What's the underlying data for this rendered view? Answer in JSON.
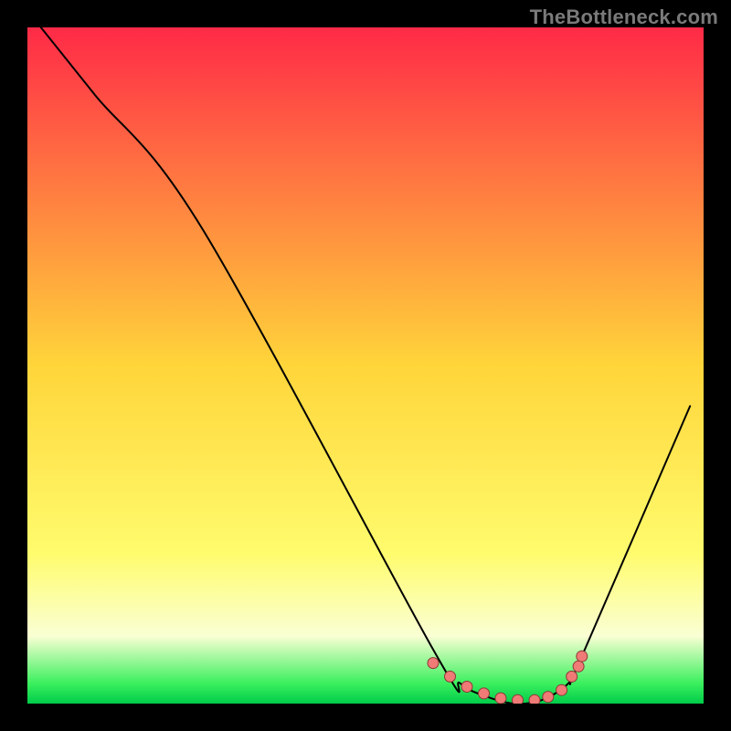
{
  "watermark": "TheBottleneck.com",
  "chart_data": {
    "type": "line",
    "title": "",
    "xlabel": "",
    "ylabel": "",
    "xlim": [
      0,
      100
    ],
    "ylim": [
      0,
      100
    ],
    "grid": false,
    "legend": "none",
    "background_gradient": {
      "stops": [
        {
          "offset": 0.0,
          "color": "#ff2a47"
        },
        {
          "offset": 0.5,
          "color": "#ffd53a"
        },
        {
          "offset": 0.78,
          "color": "#fffc6e"
        },
        {
          "offset": 0.9,
          "color": "#faffd4"
        },
        {
          "offset": 0.97,
          "color": "#3bf05e"
        },
        {
          "offset": 1.0,
          "color": "#00cc4a"
        }
      ]
    },
    "series": [
      {
        "name": "bottleneck-curve",
        "color": "#000000",
        "width": 2,
        "x": [
          2,
          10,
          26,
          60,
          64,
          68,
          72,
          76,
          80,
          82,
          98
        ],
        "values": [
          100,
          90,
          70,
          8,
          3,
          1,
          0,
          0.5,
          3,
          7,
          44
        ]
      }
    ],
    "markers": {
      "name": "optimal-range-points",
      "color": "#ef7a76",
      "stroke": "#8c3a37",
      "radius": 6,
      "x": [
        60,
        62.5,
        65,
        67.5,
        70,
        72.5,
        75,
        77,
        79,
        80.5,
        81.5,
        82
      ],
      "values": [
        6,
        4,
        2.5,
        1.5,
        0.8,
        0.5,
        0.5,
        1,
        2,
        4,
        5.5,
        7
      ]
    }
  }
}
